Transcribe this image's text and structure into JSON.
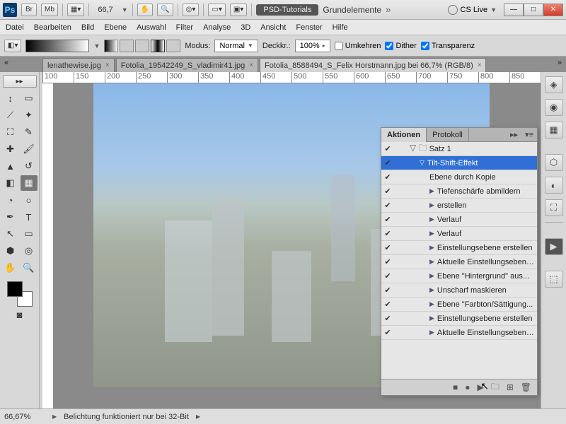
{
  "titlebar": {
    "zoom": "66,7",
    "pill": "PSD-Tutorials",
    "title": "Grundelemente",
    "cslive": "CS Live"
  },
  "menu": [
    "Datei",
    "Bearbeiten",
    "Bild",
    "Ebene",
    "Auswahl",
    "Filter",
    "Analyse",
    "3D",
    "Ansicht",
    "Fenster",
    "Hilfe"
  ],
  "options": {
    "modus_label": "Modus:",
    "modus_value": "Normal",
    "deckkr_label": "Deckkr.:",
    "deckkr_value": "100%",
    "umkehren": "Umkehren",
    "dither": "Dither",
    "transparenz": "Transparenz"
  },
  "tabs": [
    {
      "label": "lenathewise.jpg",
      "active": false
    },
    {
      "label": "Fotolia_19542249_S_vladimir41.jpg",
      "active": false
    },
    {
      "label": "Fotolia_8588494_S_Felix Horstmann.jpg bei 66,7% (RGB/8)",
      "active": true
    }
  ],
  "ruler_marks": [
    100,
    150,
    200,
    250,
    300,
    350,
    400,
    450,
    500,
    550,
    600,
    650,
    700,
    750,
    800,
    850
  ],
  "panel": {
    "tabs": [
      "Aktionen",
      "Protokoll"
    ],
    "root": "Satz 1",
    "selected": "Tilt-Shift-Effekt",
    "steps": [
      {
        "name": "Ebene durch Kopie",
        "arrow": false
      },
      {
        "name": "Tiefenschärfe abmildern",
        "arrow": true
      },
      {
        "name": "erstellen",
        "arrow": true
      },
      {
        "name": "Verlauf",
        "arrow": true
      },
      {
        "name": "Verlauf",
        "arrow": true
      },
      {
        "name": "Einstellungsebene erstellen",
        "arrow": true
      },
      {
        "name": "Aktuelle Einstellungsebene...",
        "arrow": true
      },
      {
        "name": "Ebene \"Hintergrund\" aus...",
        "arrow": true
      },
      {
        "name": "Unscharf maskieren",
        "arrow": true
      },
      {
        "name": "Ebene \"Farbton/Sättigung...",
        "arrow": true
      },
      {
        "name": "Einstellungsebene erstellen",
        "arrow": true
      },
      {
        "name": "Aktuelle Einstellungsebene...",
        "arrow": true
      }
    ]
  },
  "status": {
    "zoom": "66,67%",
    "msg": "Belichtung funktioniert nur bei 32-Bit"
  }
}
